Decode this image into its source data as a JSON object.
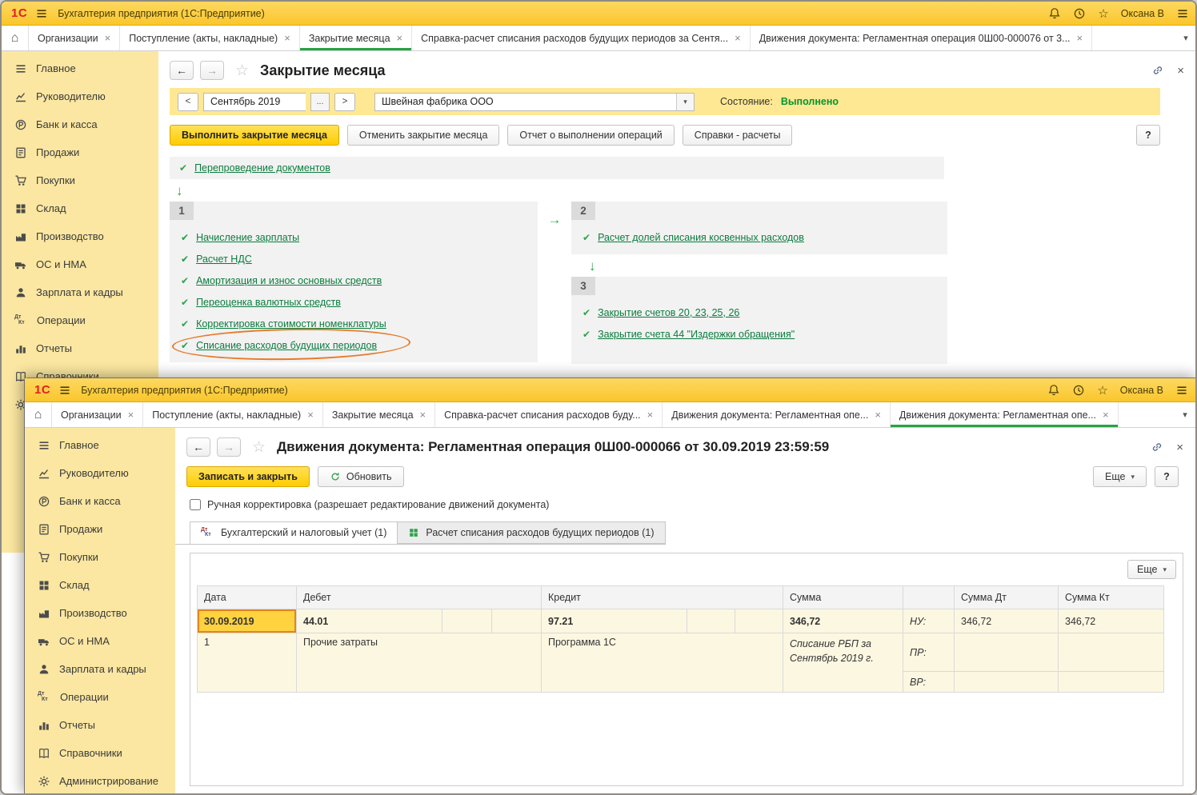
{
  "app": {
    "logo": "1С",
    "title": "Бухгалтерия предприятия  (1С:Предприятие)",
    "user": "Оксана В"
  },
  "icons": {
    "close": "×",
    "home": "⌂",
    "dropdown": "▾",
    "star": "☆",
    "back": "←",
    "forward": "→",
    "check": "✔",
    "arrow_down": "↓",
    "arrow_right": "→",
    "prev": "<",
    "next": ">",
    "dots": "...",
    "dt": "Дт",
    "kt": "Кт"
  },
  "sidebar": {
    "items": [
      {
        "label": "Главное"
      },
      {
        "label": "Руководителю"
      },
      {
        "label": "Банк и касса"
      },
      {
        "label": "Продажи"
      },
      {
        "label": "Покупки"
      },
      {
        "label": "Склад"
      },
      {
        "label": "Производство"
      },
      {
        "label": "ОС и НМА"
      },
      {
        "label": "Зарплата и кадры"
      },
      {
        "label": "Операции"
      },
      {
        "label": "Отчеты"
      },
      {
        "label": "Справочники"
      },
      {
        "label": "Администрирование"
      }
    ]
  },
  "win1": {
    "tabs": [
      {
        "label": "Организации"
      },
      {
        "label": "Поступление (акты, накладные)"
      },
      {
        "label": "Закрытие месяца"
      },
      {
        "label": "Справка-расчет списания расходов будущих периодов за Сентя..."
      },
      {
        "label": "Движения документа: Регламентная операция 0Ш00-000076 от 3..."
      }
    ],
    "page": {
      "title": "Закрытие месяца",
      "period_value": "Сентябрь 2019",
      "org": "Швейная фабрика ООО",
      "state_label": "Состояние:",
      "state_value": "Выполнено",
      "btn_run": "Выполнить закрытие месяца",
      "btn_cancel": "Отменить закрытие месяца",
      "btn_report": "Отчет о выполнении операций",
      "btn_refs": "Справки - расчеты",
      "btn_help": "?",
      "reposting_link": "Перепроведение документов",
      "block1": {
        "num": "1",
        "items": [
          {
            "label": "Начисление зарплаты"
          },
          {
            "label": "Расчет НДС"
          },
          {
            "label": "Амортизация и износ основных средств"
          },
          {
            "label": "Переоценка валютных средств"
          },
          {
            "label": "Корректировка стоимости номенклатуры"
          },
          {
            "label": "Списание расходов будущих периодов"
          }
        ]
      },
      "block2": {
        "num": "2",
        "items": [
          {
            "label": "Расчет долей списания косвенных расходов"
          }
        ]
      },
      "block3": {
        "num": "3",
        "items": [
          {
            "label": "Закрытие счетов 20, 23, 25, 26"
          },
          {
            "label": "Закрытие счета 44 \"Издержки обращения\""
          }
        ]
      }
    }
  },
  "win2": {
    "tabs": [
      {
        "label": "Организации"
      },
      {
        "label": "Поступление (акты, накладные)"
      },
      {
        "label": "Закрытие месяца"
      },
      {
        "label": "Справка-расчет списания расходов буду..."
      },
      {
        "label": "Движения документа: Регламентная опе..."
      },
      {
        "label": "Движения документа: Регламентная опе..."
      }
    ],
    "page": {
      "title": "Движения документа: Регламентная операция 0Ш00-000066 от 30.09.2019 23:59:59",
      "btn_save": "Записать и закрыть",
      "btn_refresh": "Обновить",
      "btn_more": "Еще",
      "btn_help": "?",
      "manual_label": "Ручная корректировка (разрешает редактирование движений документа)",
      "doc_tabs": [
        {
          "label": "Бухгалтерский и налоговый учет (1)"
        },
        {
          "label": "Расчет списания расходов будущих периодов (1)"
        }
      ],
      "table": {
        "headers": {
          "date": "Дата",
          "debit": "Дебет",
          "credit": "Кредит",
          "amount": "Сумма",
          "sum_dt": "Сумма Дт",
          "sum_kt": "Сумма Кт"
        },
        "record": {
          "date": "30.09.2019",
          "line_no": "1",
          "debit_account": "44.01",
          "debit_subconto": "Прочие затраты",
          "credit_account": "97.21",
          "credit_subconto": "Программа 1С",
          "amount": "346,72",
          "comment": "Списание РБП за Сентябрь 2019 г.",
          "nu": "НУ:",
          "pr": "ПР:",
          "vr": "ВР:",
          "nu_sum_dt": "346,72",
          "nu_sum_kt": "346,72"
        }
      }
    }
  }
}
